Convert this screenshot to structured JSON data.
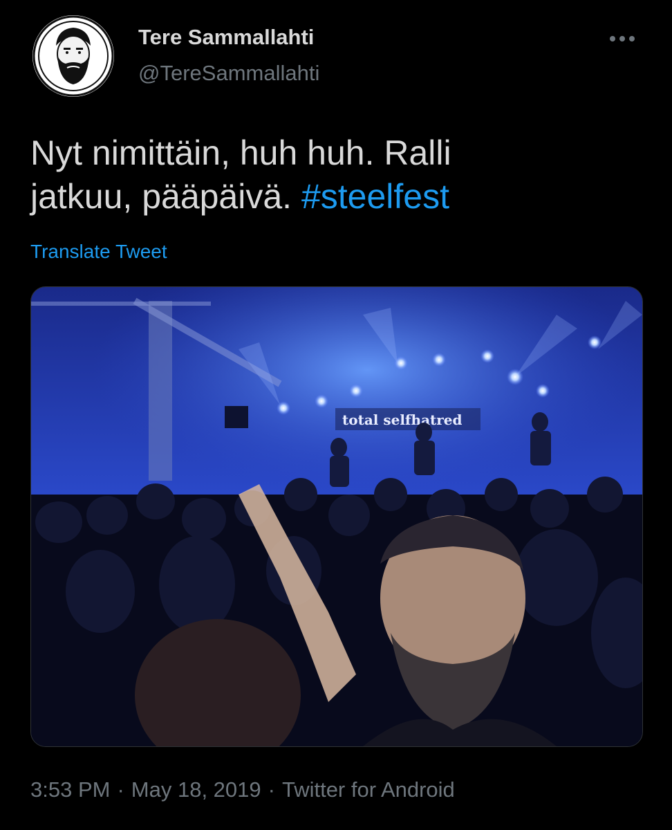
{
  "author": {
    "display_name": "Tere Sammallahti",
    "handle": "@TereSammallahti",
    "avatar_icon": "bearded-man-avatar"
  },
  "menu": {
    "icon": "more-options-icon"
  },
  "tweet": {
    "text_line1": "Nyt nimittäin, huh huh. Ralli",
    "text_line2": "jatkuu, pääpäivä.",
    "hashtag": "#steelfest",
    "translate_label": "Translate Tweet"
  },
  "media": {
    "description": "concert-selfie-photo",
    "stage_banner": "total selfhatred"
  },
  "meta": {
    "time": "3:53 PM",
    "separator": "·",
    "date": "May 18, 2019",
    "source": "Twitter for Android"
  },
  "colors": {
    "background": "#000000",
    "text": "#d9d9d9",
    "secondary": "#6e767d",
    "link": "#1d9bf0"
  }
}
